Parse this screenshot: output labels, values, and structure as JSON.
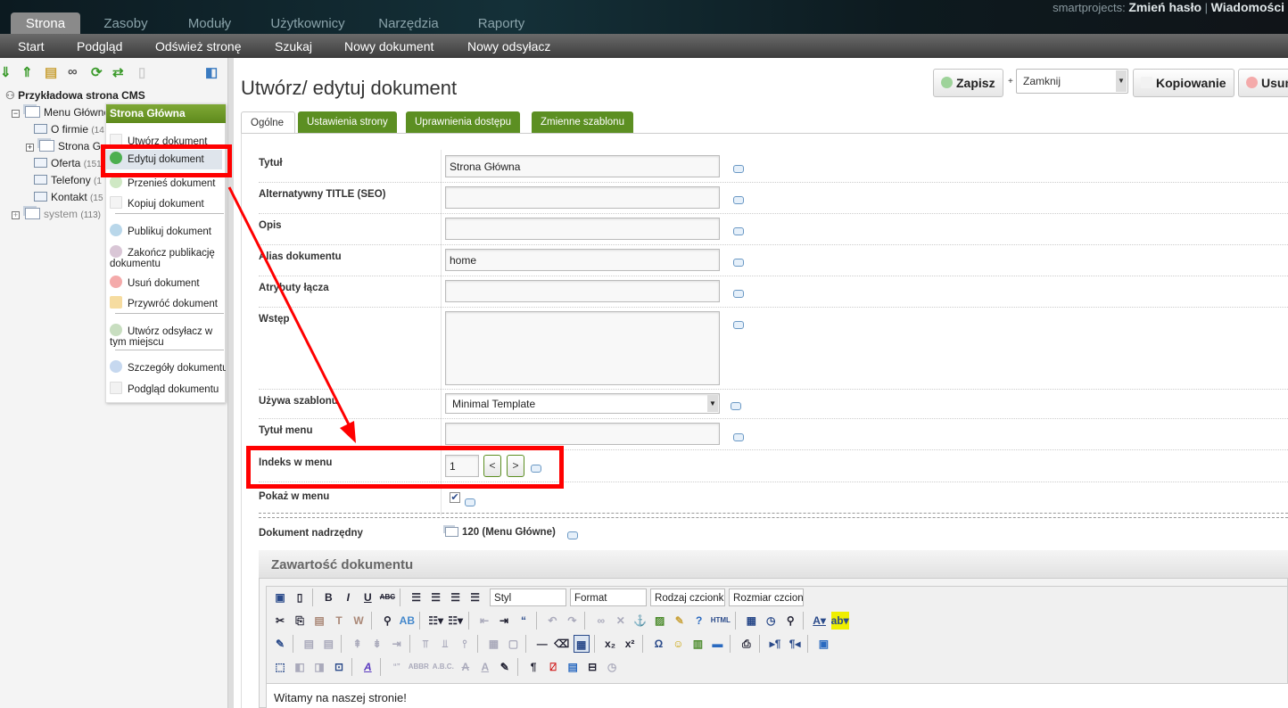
{
  "header": {
    "tabs": [
      "Strona",
      "Zasoby",
      "Moduły",
      "Użytkownicy",
      "Narzędzia",
      "Raporty"
    ],
    "active_tab": "Strona",
    "user": "smartprojects:",
    "change_password": "Zmień hasło",
    "separator": "|",
    "messages": "Wiadomości"
  },
  "subnav": [
    "Start",
    "Podgląd",
    "Odśwież stronę",
    "Szukaj",
    "Nowy dokument",
    "Nowy odsyłacz"
  ],
  "tree": {
    "toolbar_icons": [
      "expand-icon",
      "collapse-icon",
      "new-document-icon",
      "new-weblink-icon",
      "refresh-icon",
      "sort-icon",
      "trash-icon",
      "hide-tree-icon"
    ],
    "root": "Przykładowa strona CMS",
    "items": [
      {
        "label": "Menu Główne",
        "count": ""
      },
      {
        "label": "O firmie",
        "count": "(14"
      },
      {
        "label": "Strona G",
        "count": ""
      },
      {
        "label": "Oferta",
        "count": "(151"
      },
      {
        "label": "Telefony",
        "count": "(1"
      },
      {
        "label": "Kontakt",
        "count": "(15"
      },
      {
        "label": "system",
        "count": "(113)"
      }
    ]
  },
  "context_menu": {
    "title": "Strona Główna",
    "items": [
      "Utwórz dokument",
      "Edytuj dokument",
      "Przenieś dokument",
      "Kopiuj dokument",
      "Publikuj dokument",
      "Zakończ publikację dokumentu",
      "Usuń dokument",
      "Przywróć dokument",
      "Utwórz odsyłacz w tym miejscu",
      "Szczegóły dokumentu",
      "Podgląd dokumentu"
    ]
  },
  "page": {
    "title": "Utwórz/ edytuj dokument",
    "actions": {
      "save": "Zapisz",
      "plus": "+",
      "after_save": "Zamknij",
      "copy": "Kopiowanie",
      "delete": "Usuń"
    },
    "tabs": [
      "Ogólne",
      "Ustawienia strony",
      "Uprawnienia dostępu",
      "Zmienne szablonu"
    ],
    "fields": {
      "title_label": "Tytuł",
      "title_value": "Strona Główna",
      "seo_label": "Alternatywny TITLE (SEO)",
      "desc_label": "Opis",
      "alias_label": "Alias dokumentu",
      "alias_value": "home",
      "link_attr_label": "Atrybuty łącza",
      "intro_label": "Wstęp",
      "template_label": "Używa szablonu",
      "template_value": "Minimal Template",
      "menu_title_label": "Tytuł menu",
      "menu_index_label": "Indeks w menu",
      "menu_index_value": "1",
      "prev": "<",
      "next": ">",
      "show_menu_label": "Pokaż w menu",
      "show_menu_checked": true,
      "parent_label": "Dokument nadrzędny",
      "parent_value": "120 (Menu Główne)"
    },
    "content": {
      "title": "Zawartość dokumentu",
      "dropdowns": [
        "Styl",
        "Format",
        "Rodzaj czcionki",
        "Rozmiar czcionki"
      ],
      "text": "Witamy na naszej stronie!"
    }
  },
  "colors": {
    "accent_green": "#5c8f22",
    "highlight_red": "#ff0000"
  }
}
